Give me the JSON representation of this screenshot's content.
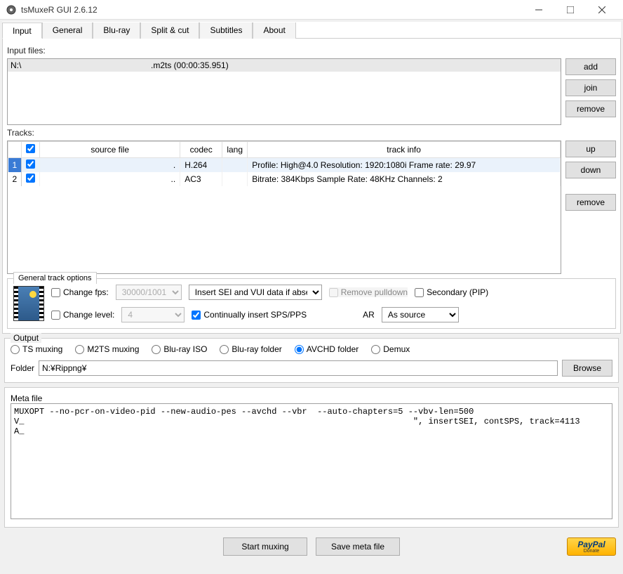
{
  "window": {
    "title": "tsMuxeR GUI 2.6.12"
  },
  "tabs": [
    "Input",
    "General",
    "Blu-ray",
    "Split & cut",
    "Subtitles",
    "About"
  ],
  "activeTab": 0,
  "labels": {
    "inputFiles": "Input files:",
    "tracks": "Tracks:",
    "generalTrackOptions": "General track options",
    "output": "Output",
    "folder": "Folder",
    "metaFile": "Meta file"
  },
  "inputFilesList": [
    {
      "name": "N:\\",
      "info": ".m2ts (00:00:35.951)"
    }
  ],
  "fileButtons": {
    "add": "add",
    "join": "join",
    "remove": "remove"
  },
  "tracksHeaders": {
    "sourceFile": "source file",
    "codec": "codec",
    "lang": "lang",
    "trackInfo": "track info"
  },
  "tracks": [
    {
      "num": "1",
      "checked": true,
      "source": ".",
      "codec": "H.264",
      "lang": "",
      "info": "Profile: High@4.0  Resolution: 1920:1080i  Frame rate: 29.97",
      "selected": true
    },
    {
      "num": "2",
      "checked": true,
      "source": "..",
      "codec": "AC3",
      "lang": "",
      "info": "Bitrate: 384Kbps Sample Rate: 48KHz Channels: 2",
      "selected": false
    }
  ],
  "trackButtons": {
    "up": "up",
    "down": "down",
    "remove": "remove"
  },
  "gto": {
    "changeFps": "Change fps:",
    "fpsValue": "30000/1001",
    "seiOptions": "Insert SEI and VUI data if absent",
    "removePulldown": "Remove pulldown",
    "secondaryPip": "Secondary (PIP)",
    "changeLevel": "Change level:",
    "levelValue": "4",
    "contSpsPps": "Continually insert SPS/PPS",
    "ar": "AR",
    "arValue": "As source"
  },
  "output": {
    "options": [
      "TS muxing",
      "M2TS muxing",
      "Blu-ray ISO",
      "Blu-ray folder",
      "AVCHD folder",
      "Demux"
    ],
    "selected": 4,
    "folderValue": "N:¥Rippng¥",
    "browse": "Browse"
  },
  "metaFile": "MUXOPT --no-pcr-on-video-pid --new-audio-pes --avchd --vbr  --auto-chapters=5 --vbv-len=500\nV_                                                                             \", insertSEI, contSPS, track=4113\nA_",
  "bottom": {
    "startMuxing": "Start muxing",
    "saveMetaFile": "Save meta file",
    "paypal": "PayPal",
    "donate": "Donate"
  }
}
